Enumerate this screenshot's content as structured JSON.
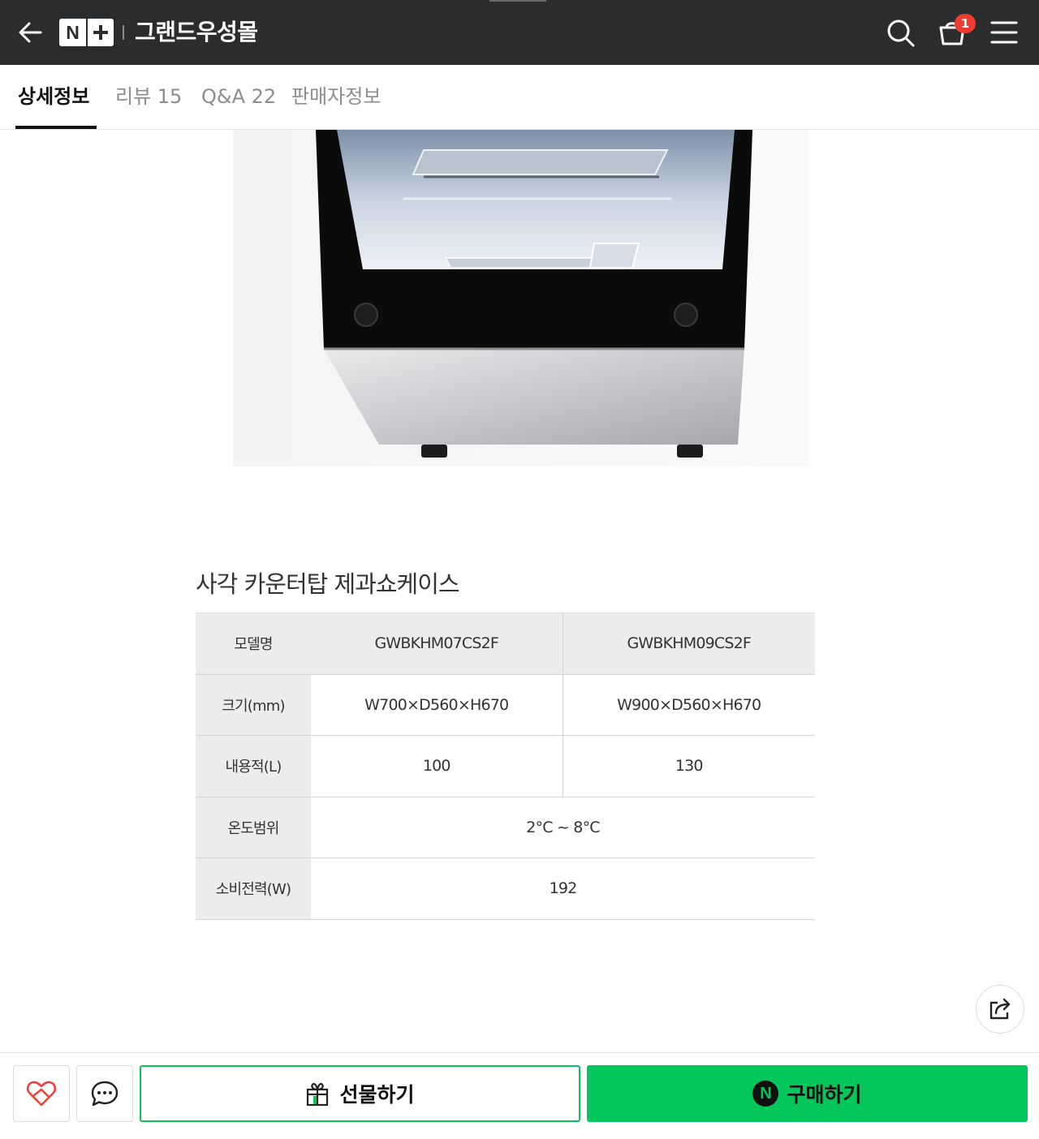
{
  "header": {
    "logo_letter": "N",
    "store_name": "그랜드우성몰",
    "cart_count": "1",
    "icons": [
      "back-arrow-icon",
      "search-icon",
      "cart-icon",
      "menu-icon"
    ],
    "background_color": "#2b2c2e"
  },
  "tabs": [
    {
      "label": "상세정보",
      "active": true
    },
    {
      "label": "리뷰 15",
      "active": false
    },
    {
      "label": "Q&A 22",
      "active": false
    },
    {
      "label": "판매자정보",
      "active": false
    }
  ],
  "spec": {
    "title": "사각 카운터탑 제과쇼케이스",
    "rows": [
      {
        "label": "모델명",
        "col1": "GWBKHM07CS2F",
        "col2": "GWBKHM09CS2F"
      },
      {
        "label": "크기(mm)",
        "col1": "W700×D560×H670",
        "col2": "W900×D560×H670"
      },
      {
        "label": "내용적(L)",
        "col1": "100",
        "col2": "130"
      },
      {
        "label": "온도범위",
        "merged": "2°C ~ 8°C"
      },
      {
        "label": "소비전력(W)",
        "merged": "192"
      }
    ]
  },
  "bottom_bar": {
    "gift_label": "선물하기",
    "buy_label": "구매하기",
    "npay_letter": "N",
    "accent_color": "#03c75a"
  }
}
